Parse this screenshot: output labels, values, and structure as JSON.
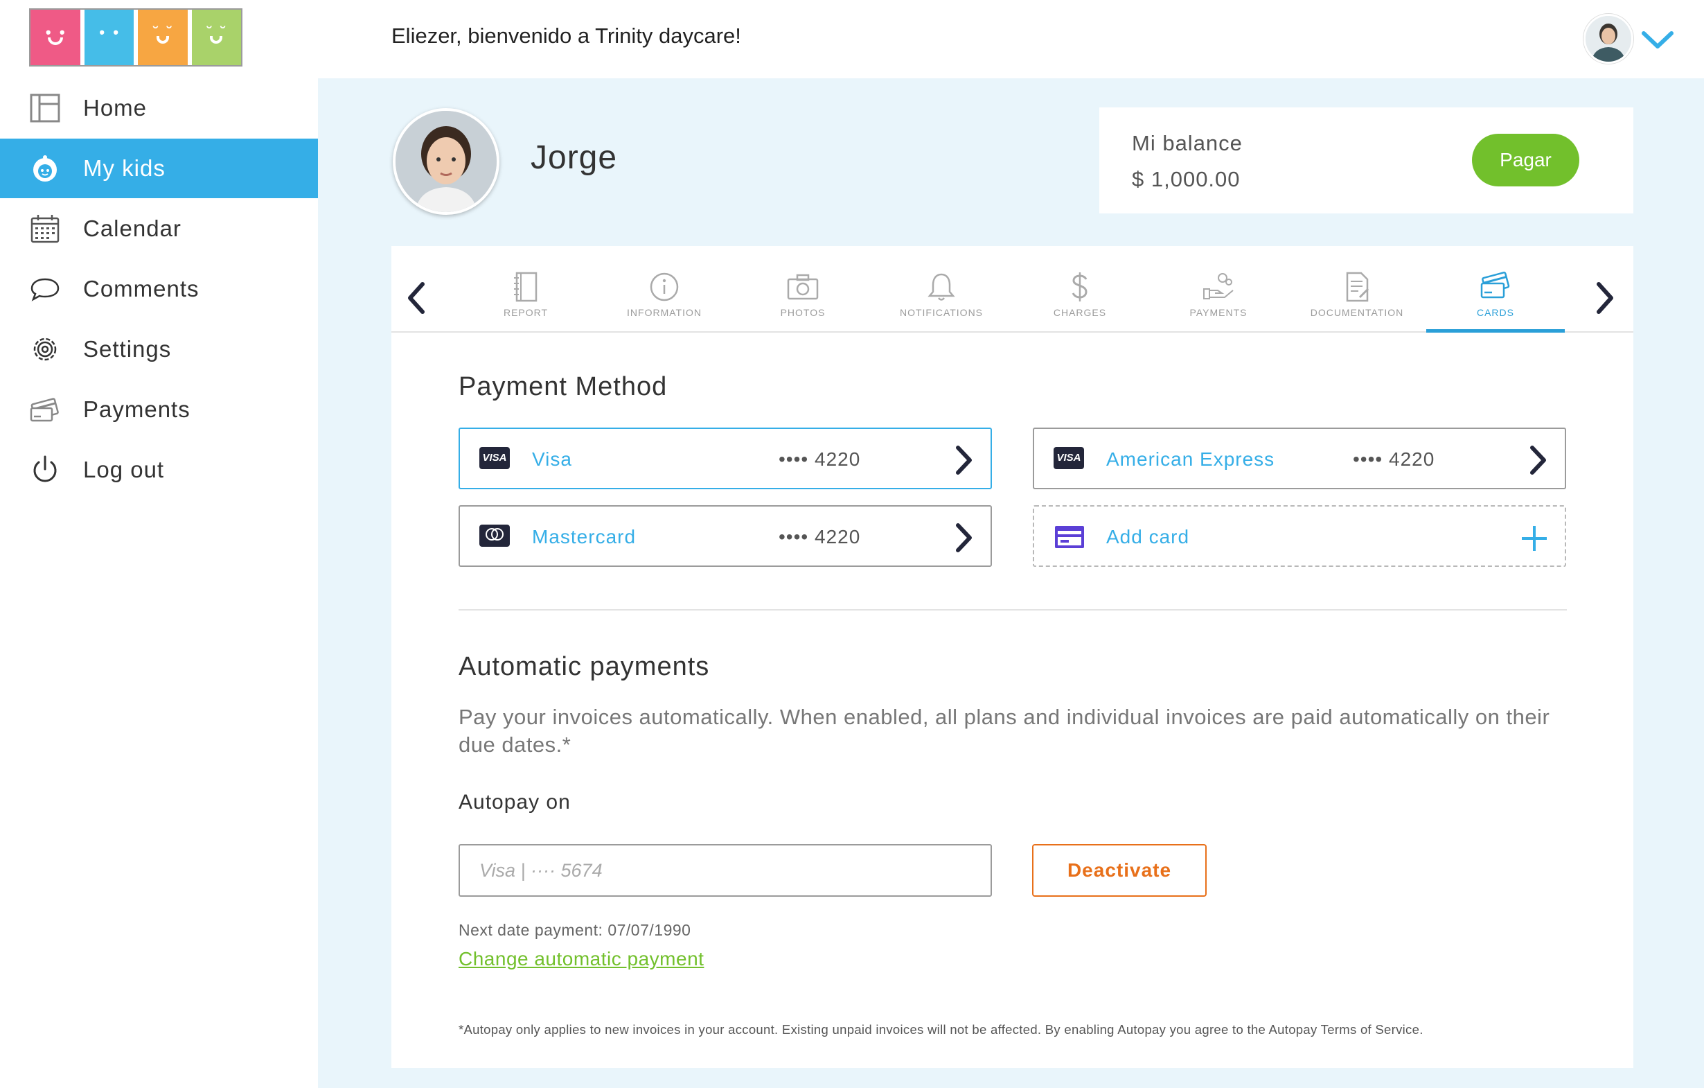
{
  "header": {
    "greeting": "Eliezer, bienvenido a Trinity daycare!"
  },
  "logo": {
    "colors": [
      "#ef5a86",
      "#45bde8",
      "#f7a642",
      "#a9d26a"
    ]
  },
  "sidebar": {
    "items": [
      {
        "label": "Home",
        "icon": "layout-icon",
        "active": false
      },
      {
        "label": "My kids",
        "icon": "baby-icon",
        "active": true
      },
      {
        "label": "Calendar",
        "icon": "calendar-icon",
        "active": false
      },
      {
        "label": "Comments",
        "icon": "speech-bubble-icon",
        "active": false
      },
      {
        "label": "Settings",
        "icon": "gear-icon",
        "active": false
      },
      {
        "label": "Payments",
        "icon": "cards-icon",
        "active": false
      },
      {
        "label": "Log out",
        "icon": "power-icon",
        "active": false
      }
    ]
  },
  "kid": {
    "name": "Jorge"
  },
  "balance": {
    "title": "Mi balance",
    "amount": "$ 1,000.00",
    "pay_label": "Pagar"
  },
  "tabs": [
    {
      "label": "REPORT",
      "icon": "notebook-icon",
      "active": false
    },
    {
      "label": "INFORMATION",
      "icon": "info-icon",
      "active": false
    },
    {
      "label": "PHOTOS",
      "icon": "camera-icon",
      "active": false
    },
    {
      "label": "NOTIFICATIONS",
      "icon": "bell-icon",
      "active": false
    },
    {
      "label": "CHARGES",
      "icon": "dollar-icon",
      "active": false
    },
    {
      "label": "PAYMENTS",
      "icon": "hand-coins-icon",
      "active": false
    },
    {
      "label": "DOCUMENTATION",
      "icon": "document-icon",
      "active": false
    },
    {
      "label": "CARDS",
      "icon": "credit-cards-icon",
      "active": true
    }
  ],
  "payment_method": {
    "title": "Payment Method",
    "cards": [
      {
        "brand": "VISA",
        "name": "Visa",
        "number": "•••• 4220",
        "selected": true
      },
      {
        "brand": "VISA",
        "name": "American Express",
        "number": "•••• 4220",
        "selected": false
      },
      {
        "brand": "mastercard",
        "name": "Mastercard",
        "number": "•••• 4220",
        "selected": false
      }
    ],
    "add_card_label": "Add card"
  },
  "automatic": {
    "title": "Automatic payments",
    "description": "Pay your invoices automatically. When enabled, all plans and individual invoices are paid automatically on their due dates.*",
    "autopay_label": "Autopay on",
    "input_placeholder": "Visa | ···· 5674",
    "deactivate_label": "Deactivate",
    "next_date": "Next date payment: 07/07/1990",
    "change_link": "Change automatic payment",
    "footnote": "*Autopay only applies to new invoices in your account. Existing unpaid invoices will not be affected. By enabling Autopay you agree to the Autopay Terms of Service."
  },
  "colors": {
    "accent": "#35aee7",
    "tab_active": "#2a9fd8",
    "pay_green": "#72c02c",
    "deactivate_orange": "#e8701a",
    "main_bg": "#e9f5fb"
  }
}
